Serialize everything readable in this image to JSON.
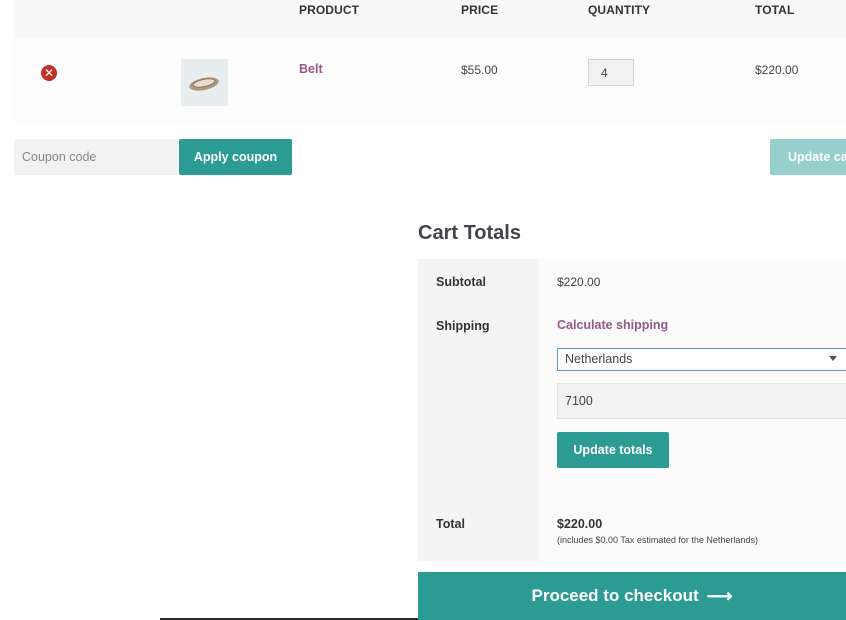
{
  "cart": {
    "headers": {
      "product": "PRODUCT",
      "price": "PRICE",
      "quantity": "QUANTITY",
      "total": "TOTAL"
    },
    "items": [
      {
        "remove_symbol": "✕",
        "product": "Belt",
        "price": "$55.00",
        "quantity": "4",
        "total": "$220.00"
      }
    ]
  },
  "coupon": {
    "placeholder": "Coupon code",
    "apply_label": "Apply coupon",
    "update_cart_label": "Update cart"
  },
  "cart_totals": {
    "title": "Cart Totals",
    "subtotal_label": "Subtotal",
    "subtotal_value": "$220.00",
    "shipping_label": "Shipping",
    "calculate_shipping_label": "Calculate shipping",
    "country": "Netherlands",
    "postcode": "7100",
    "update_totals_label": "Update totals",
    "total_label": "Total",
    "total_value": "$220.00",
    "tax_note": "(includes $0.00 Tax estimated for the Netherlands)"
  },
  "checkout": {
    "label": "Proceed to checkout",
    "arrow": "⟶"
  },
  "colors": {
    "accent": "#2c9b94",
    "link": "#96588a",
    "remove": "#c3302b"
  },
  "icons": [
    "remove-icon",
    "product-thumbnail",
    "chevron-down-icon",
    "arrow-right-icon"
  ]
}
